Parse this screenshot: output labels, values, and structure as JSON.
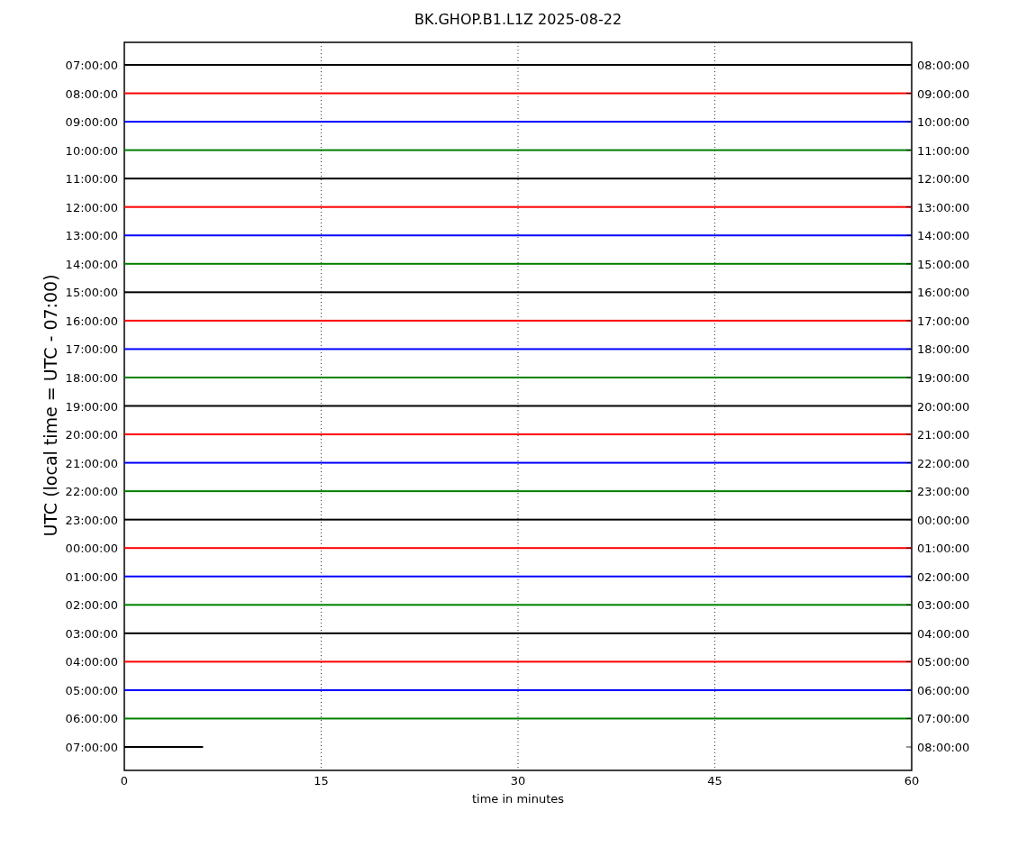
{
  "title": "BK.GHOP.B1.L1Z 2025-08-22",
  "ylabel": "UTC (local time = UTC - 07:00)",
  "xlabel": "time in minutes",
  "xticks": [
    "0",
    "15",
    "30",
    "45",
    "60"
  ],
  "rows": [
    {
      "left": "07:00:00",
      "right": "08:00:00",
      "color": "#000000",
      "level": 1
    },
    {
      "left": "08:00:00",
      "right": "09:00:00",
      "color": "#ff0000",
      "level": 1
    },
    {
      "left": "09:00:00",
      "right": "10:00:00",
      "color": "#0000ff",
      "level": 1
    },
    {
      "left": "10:00:00",
      "right": "11:00:00",
      "color": "#008000",
      "level": 1
    },
    {
      "left": "11:00:00",
      "right": "12:00:00",
      "color": "#000000",
      "level": 1
    },
    {
      "left": "12:00:00",
      "right": "13:00:00",
      "color": "#ff0000",
      "level": 1
    },
    {
      "left": "13:00:00",
      "right": "14:00:00",
      "color": "#0000ff",
      "level": 1
    },
    {
      "left": "14:00:00",
      "right": "15:00:00",
      "color": "#008000",
      "level": 1
    },
    {
      "left": "15:00:00",
      "right": "16:00:00",
      "color": "#000000",
      "level": 1
    },
    {
      "left": "16:00:00",
      "right": "17:00:00",
      "color": "#ff0000",
      "level": 1
    },
    {
      "left": "17:00:00",
      "right": "18:00:00",
      "color": "#0000ff",
      "level": 1
    },
    {
      "left": "18:00:00",
      "right": "19:00:00",
      "color": "#008000",
      "level": 1
    },
    {
      "left": "19:00:00",
      "right": "20:00:00",
      "color": "#000000",
      "level": 1
    },
    {
      "left": "20:00:00",
      "right": "21:00:00",
      "color": "#ff0000",
      "level": 1
    },
    {
      "left": "21:00:00",
      "right": "22:00:00",
      "color": "#0000ff",
      "level": 1
    },
    {
      "left": "22:00:00",
      "right": "23:00:00",
      "color": "#008000",
      "level": 1
    },
    {
      "left": "23:00:00",
      "right": "00:00:00",
      "color": "#000000",
      "level": 1
    },
    {
      "left": "00:00:00",
      "right": "01:00:00",
      "color": "#ff0000",
      "level": 1
    },
    {
      "left": "01:00:00",
      "right": "02:00:00",
      "color": "#0000ff",
      "level": 1
    },
    {
      "left": "02:00:00",
      "right": "03:00:00",
      "color": "#008000",
      "level": 1
    },
    {
      "left": "03:00:00",
      "right": "04:00:00",
      "color": "#000000",
      "level": 1
    },
    {
      "left": "04:00:00",
      "right": "05:00:00",
      "color": "#ff0000",
      "level": 1
    },
    {
      "left": "05:00:00",
      "right": "06:00:00",
      "color": "#0000ff",
      "level": 1
    },
    {
      "left": "06:00:00",
      "right": "07:00:00",
      "color": "#008000",
      "level": 1
    },
    {
      "left": "07:00:00",
      "right": "08:00:00",
      "color": "#000000",
      "level": 0.1
    }
  ]
}
